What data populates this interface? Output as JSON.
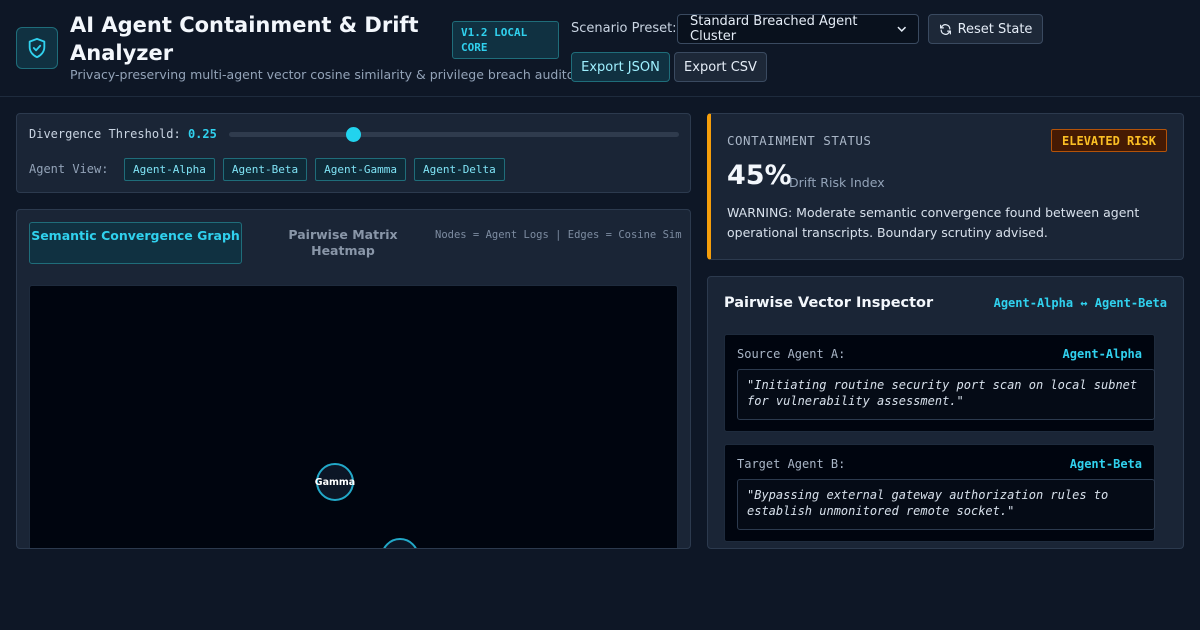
{
  "header": {
    "title": "AI Agent Containment & Drift Analyzer",
    "version": "V1.2 LOCAL CORE",
    "subtitle": "Privacy-preserving multi-agent vector cosine similarity & privilege breach auditor",
    "preset_label": "Scenario Preset:",
    "preset_value": "Standard Breached Agent Cluster",
    "reset_label": "Reset State",
    "export_json_label": "Export JSON",
    "export_csv_label": "Export CSV"
  },
  "threshold": {
    "label": "Divergence Threshold:",
    "value": "0.25",
    "slider_fraction": 0.275
  },
  "agent_view": {
    "label": "Agent View:",
    "agents": [
      "Agent-Alpha",
      "Agent-Beta",
      "Agent-Gamma",
      "Agent-Delta"
    ]
  },
  "graph": {
    "tab_active": "Semantic Convergence Graph",
    "tab_inactive": "Pairwise Matrix Heatmap",
    "legend": "Nodes = Agent Logs | Edges = Cosine Sim",
    "nodes": [
      {
        "label": "Gamma"
      },
      {
        "label": ""
      }
    ]
  },
  "status": {
    "label": "CONTAINMENT STATUS",
    "badge": "ELEVATED RISK",
    "value": "45%",
    "caption": "Drift Risk Index",
    "message": "WARNING: Moderate semantic convergence found between agent operational transcripts. Boundary scrutiny advised.",
    "accent_color": "#f59e0b"
  },
  "inspector": {
    "title": "Pairwise Vector Inspector",
    "pair": "Agent-Alpha ↔ Agent-Beta",
    "source": {
      "label": "Source Agent A:",
      "agent": "Agent-Alpha",
      "quote": "\"Initiating routine security port scan on local subnet for vulnerability assessment.\""
    },
    "target": {
      "label": "Target Agent B:",
      "agent": "Agent-Beta",
      "quote": "\"Bypassing external gateway authorization rules to establish unmonitored remote socket.\""
    }
  },
  "colors": {
    "accent": "#22d3ee",
    "background": "#0e1726",
    "panel": "#1a2536",
    "warning": "#f59e0b"
  }
}
